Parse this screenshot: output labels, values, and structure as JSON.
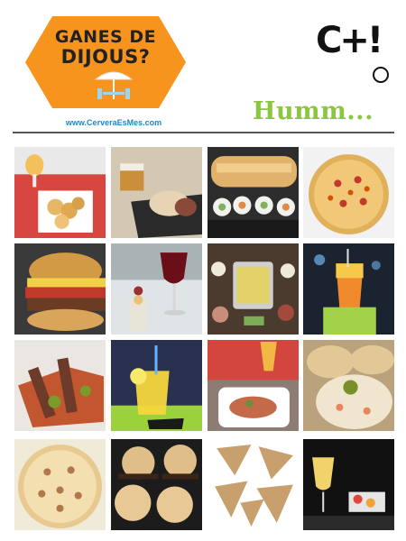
{
  "header": {
    "badge_line1": "GANES DE",
    "badge_line2": "DIJOUS?",
    "site_url": "www.CerveraEsMes.com",
    "brand": "C+!",
    "tagline": "Humm..."
  },
  "colors": {
    "badge_orange": "#f7941d",
    "tagline_green": "#8cc63f",
    "url_blue": "#1e88c8"
  },
  "photos": [
    {
      "name": "beer-and-chips-photo"
    },
    {
      "name": "beer-and-bread-photo"
    },
    {
      "name": "baguette-and-sushi-rolls-photo"
    },
    {
      "name": "pizza-photo"
    },
    {
      "name": "burger-photo"
    },
    {
      "name": "red-wine-and-skewer-photo"
    },
    {
      "name": "tapas-spread-photo"
    },
    {
      "name": "cocktail-photo"
    },
    {
      "name": "anchovy-toast-photo"
    },
    {
      "name": "lemonade-drink-photo"
    },
    {
      "name": "beer-and-bruschetta-photo"
    },
    {
      "name": "toasts-with-olive-photo"
    },
    {
      "name": "tuna-pizza-photo"
    },
    {
      "name": "mini-burgers-photo"
    },
    {
      "name": "pate-triangles-photo"
    },
    {
      "name": "white-wine-and-tapa-photo"
    }
  ]
}
